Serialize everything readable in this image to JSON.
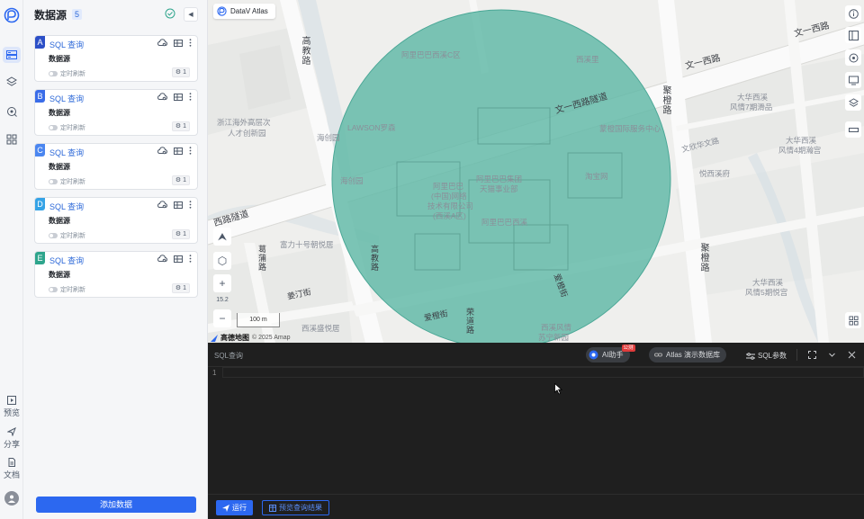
{
  "panel": {
    "title": "数据源",
    "count": "5",
    "cards": [
      {
        "tag": "A",
        "color": "#2c4fc7",
        "type": "SQL 查询",
        "name": "数据源",
        "refresh": "定时刷新",
        "badge": "1"
      },
      {
        "tag": "B",
        "color": "#3a6ce8",
        "type": "SQL 查询",
        "name": "数据源",
        "refresh": "定时刷新",
        "badge": "1"
      },
      {
        "tag": "C",
        "color": "#4b86f0",
        "type": "SQL 查询",
        "name": "数据源",
        "refresh": "定时刷新",
        "badge": "1"
      },
      {
        "tag": "D",
        "color": "#35a3e6",
        "type": "SQL 查询",
        "name": "数据源",
        "refresh": "定时刷新",
        "badge": "1"
      },
      {
        "tag": "E",
        "color": "#2ea58c",
        "type": "SQL 查询",
        "name": "数据源",
        "refresh": "定时刷新",
        "badge": "1"
      }
    ],
    "add_button": "添加数据"
  },
  "rail": {
    "preview": "预览",
    "share": "分享",
    "docs": "文档"
  },
  "map": {
    "chip_label": "DataV Atlas",
    "zoom": "15.2",
    "scale": "100 m",
    "amap": "高德地图",
    "copyright": "© 2025 Amap",
    "circle_color": "#5fb8a6",
    "labels": [
      {
        "text": "文一西路",
        "kind": "road"
      },
      {
        "text": "文一西路隧道",
        "kind": "road"
      },
      {
        "text": "文一西路",
        "kind": "road"
      },
      {
        "text": "西路隧道",
        "kind": "road"
      },
      {
        "text": "高教路",
        "kind": "road"
      },
      {
        "text": "聚橙路",
        "kind": "road"
      },
      {
        "text": "聚橙路",
        "kind": "road"
      },
      {
        "text": "阿里巴巴西溪C区",
        "kind": "poi"
      },
      {
        "text": "西溪里",
        "kind": "poi"
      },
      {
        "text": "LAWSON罗森",
        "kind": "poi"
      },
      {
        "text": "海创园",
        "kind": "poi"
      },
      {
        "text": "海创园",
        "kind": "poi"
      },
      {
        "text": "浙江海外高层次",
        "kind": "poi"
      },
      {
        "text": "人才创新园",
        "kind": "poi"
      },
      {
        "text": "阿里巴巴",
        "kind": "poi"
      },
      {
        "text": "(中国)网络",
        "kind": "poi"
      },
      {
        "text": "技术有限公司",
        "kind": "poi"
      },
      {
        "text": "(西溪A区)",
        "kind": "poi"
      },
      {
        "text": "阿里巴巴集团",
        "kind": "poi"
      },
      {
        "text": "天猫事业部",
        "kind": "poi"
      },
      {
        "text": "阿里巴巴西溪",
        "kind": "poi"
      },
      {
        "text": "淘宝网",
        "kind": "poi"
      },
      {
        "text": "蒙橙国际服务中心",
        "kind": "poi"
      },
      {
        "text": "大华西溪",
        "kind": "poi"
      },
      {
        "text": "风情7期滑品",
        "kind": "poi"
      },
      {
        "text": "大华西溪",
        "kind": "poi"
      },
      {
        "text": "风情4期瀚宫",
        "kind": "poi"
      },
      {
        "text": "大华西溪",
        "kind": "poi"
      },
      {
        "text": "风情5期悦宫",
        "kind": "poi"
      },
      {
        "text": "悦西溪府",
        "kind": "poi"
      },
      {
        "text": "文欣华文路",
        "kind": "poi"
      },
      {
        "text": "富力十号朝悦居",
        "kind": "poi"
      },
      {
        "text": "西溪盛悦居",
        "kind": "poi"
      },
      {
        "text": "西溪风情",
        "kind": "poi"
      },
      {
        "text": "苏宁新园",
        "kind": "poi"
      },
      {
        "text": "爱橙街",
        "kind": "road"
      },
      {
        "text": "爱橙街",
        "kind": "road"
      },
      {
        "text": "姜汀街",
        "kind": "road"
      },
      {
        "text": "荣道路",
        "kind": "road"
      },
      {
        "text": "葛蒲路",
        "kind": "road"
      },
      {
        "text": "高教路",
        "kind": "road"
      }
    ]
  },
  "sql": {
    "title": "SQL查询",
    "ai_label": "AI助手",
    "ai_badge": "公测",
    "db_label": "Atlas 演示数据库",
    "param_label": "SQL参数",
    "line_number": "1",
    "run_label": "运行",
    "preview_label": "预览查询结果"
  }
}
